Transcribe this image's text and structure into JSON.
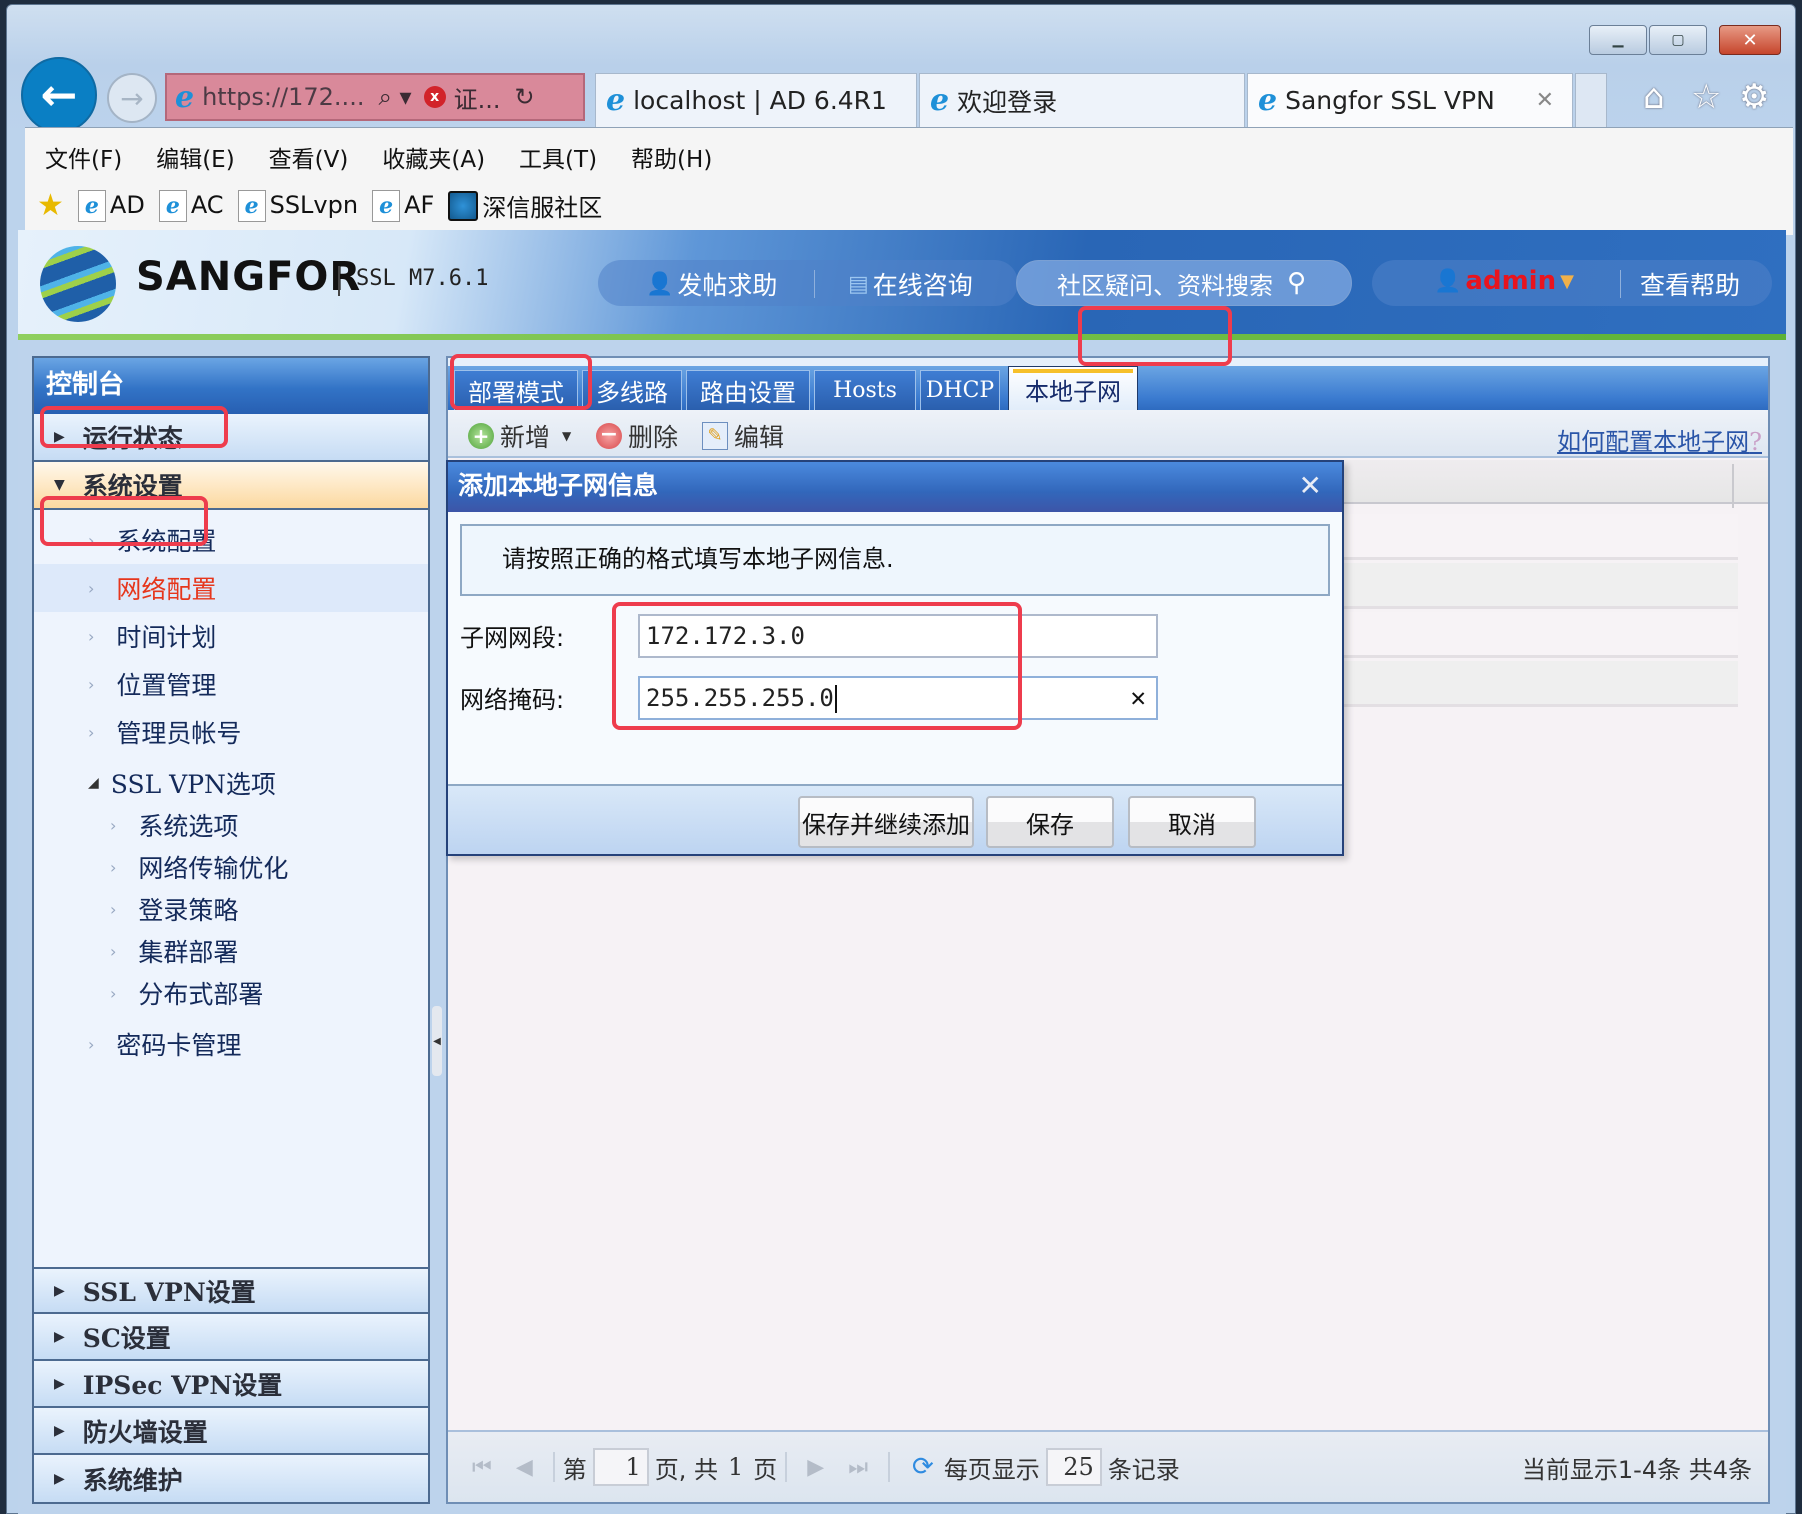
{
  "browser": {
    "address": {
      "url": "https://172....",
      "cert_error": "证..."
    },
    "tabs": [
      {
        "label": "localhost | AD 6.4R1",
        "active": false
      },
      {
        "label": "欢迎登录",
        "active": false
      },
      {
        "label": "Sangfor SSL VPN",
        "active": true
      }
    ],
    "menu": [
      "文件(F)",
      "编辑(E)",
      "查看(V)",
      "收藏夹(A)",
      "工具(T)",
      "帮助(H)"
    ],
    "favorites": [
      "AD",
      "AC",
      "SSLvpn",
      "AF",
      "深信服社区"
    ]
  },
  "header": {
    "brand": "SANGFOR",
    "version": "SSL M7.6.1",
    "post_help": "发帖求助",
    "online_consult": "在线咨询",
    "search_placeholder": "社区疑问、资料搜索",
    "user": "admin",
    "view_help": "查看帮助"
  },
  "sidebar": {
    "title": "控制台",
    "groups_top": [
      {
        "label": "运行状态",
        "expanded": false
      },
      {
        "label": "系统设置",
        "expanded": true
      }
    ],
    "items": [
      {
        "label": "系统配置"
      },
      {
        "label": "网络配置",
        "selected": true
      },
      {
        "label": "时间计划"
      },
      {
        "label": "位置管理"
      },
      {
        "label": "管理员帐号"
      }
    ],
    "ssl_options": {
      "label": "SSL VPN选项",
      "children": [
        "系统选项",
        "网络传输优化",
        "登录策略",
        "集群部署",
        "分布式部署"
      ]
    },
    "card_mgmt": "密码卡管理",
    "groups_bottom": [
      "SSL VPN设置",
      "SC设置",
      "IPSec VPN设置",
      "防火墙设置",
      "系统维护"
    ]
  },
  "content": {
    "tabs": [
      "部署模式",
      "多线路",
      "路由设置",
      "Hosts",
      "DHCP",
      "本地子网"
    ],
    "active_tab": "本地子网",
    "toolbar": {
      "add": "新增",
      "delete": "删除",
      "edit": "编辑"
    },
    "help_link": "如何配置本地子网",
    "help_link_suffix": "?",
    "grid_rows": 4,
    "pager": {
      "page_prefix": "第",
      "page": "1",
      "page_mid": "页, 共",
      "total_pages": "1",
      "page_suffix": "页",
      "per_page_prefix": "每页显示",
      "per_page": "25",
      "per_page_suffix": "条记录",
      "summary": "当前显示1-4条  共4条"
    }
  },
  "dialog": {
    "title": "添加本地子网信息",
    "note": "请按照正确的格式填写本地子网信息.",
    "subnet_label": "子网网段:",
    "subnet_value": "172.172.3.0",
    "mask_label": "网络掩码:",
    "mask_value": "255.255.255.0",
    "buttons": {
      "save_continue": "保存并继续添加",
      "save": "保存",
      "cancel": "取消"
    }
  }
}
